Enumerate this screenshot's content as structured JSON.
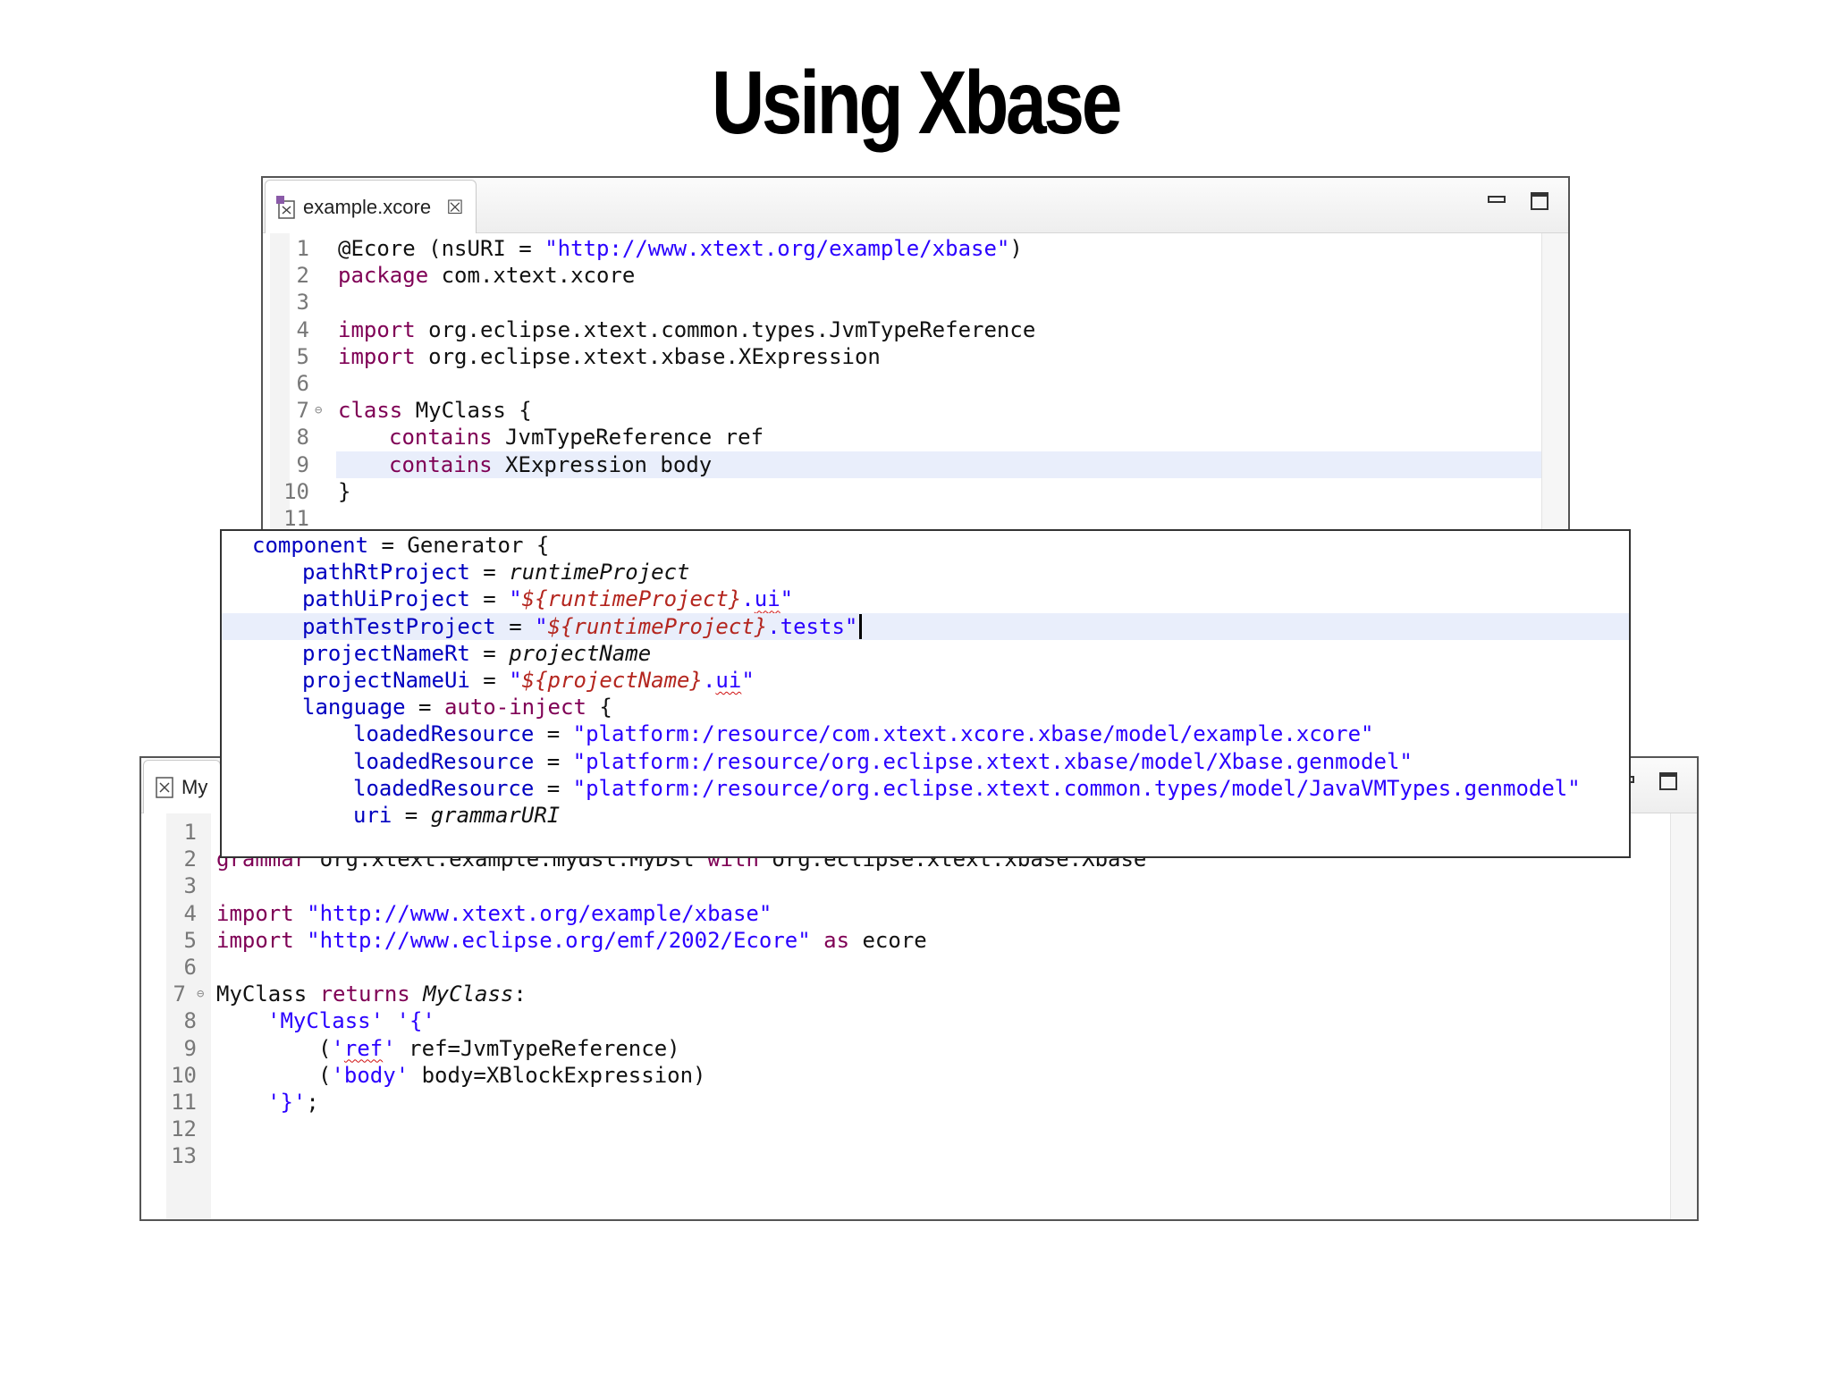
{
  "slide": {
    "title": "Using Xbase"
  },
  "xcore_editor": {
    "tab_label": "example.xcore",
    "icons": {
      "file": "xcore-file-icon",
      "close": "close-icon",
      "minimize": "minimize-icon",
      "maximize": "maximize-icon"
    },
    "line_numbers": [
      "1",
      "2",
      "3",
      "4",
      "5",
      "6",
      "7",
      "8",
      "9",
      "10",
      "11"
    ],
    "lines": {
      "l1_ecore": "@Ecore (nsURI = ",
      "l1_uri": "\"http://www.xtext.org/example/xbase\"",
      "l1_close": ")",
      "l2_kw": "package",
      "l2_rest": " com.xtext.xcore",
      "l4_kw": "import",
      "l4_rest": " org.eclipse.xtext.common.types.JvmTypeReference",
      "l5_kw": "import",
      "l5_rest": " org.eclipse.xtext.xbase.XExpression",
      "l7_kw": "class",
      "l7_rest": " MyClass {",
      "l8_kw": "contains",
      "l8_rest": " JvmTypeReference ref",
      "l9_kw": "contains",
      "l9_rest": " XExpression body",
      "l10": "}"
    }
  },
  "mwe_editor": {
    "lines": {
      "l1_prop": "component",
      "l1_rest": " = Generator {",
      "l2_prop": "pathRtProject",
      "l2_eq": " = ",
      "l2_val": "runtimeProject",
      "l3_prop": "pathUiProject",
      "l3_eq": " = ",
      "l3_q1": "\"",
      "l3_var": "${runtimeProject}",
      "l3_dot": ".",
      "l3_ui": "ui",
      "l3_q2": "\"",
      "l4_prop": "pathTestProject",
      "l4_eq": " = ",
      "l4_q1": "\"",
      "l4_var": "${runtimeProject}",
      "l4_rest": ".tests\"",
      "l5_prop": "projectNameRt",
      "l5_eq": " = ",
      "l5_val": "projectName",
      "l6_prop": "projectNameUi",
      "l6_eq": " = ",
      "l6_q1": "\"",
      "l6_var": "${projectName}",
      "l6_dot": ".",
      "l6_ui": "ui",
      "l6_q2": "\"",
      "l7_prop": "language",
      "l7_eq": " = ",
      "l7_kw": "auto-inject",
      "l7_rest": " {",
      "l8_prop": "loadedResource",
      "l8_eq": " = ",
      "l8_val": "\"platform:/resource/com.xtext.xcore.xbase/model/example.xcore\"",
      "l9_prop": "loadedResource",
      "l9_eq": " = ",
      "l9_val": "\"platform:/resource/org.eclipse.xtext.xbase/model/Xbase.genmodel\"",
      "l10_prop": "loadedResource",
      "l10_eq": " = ",
      "l10_val": "\"platform:/resource/org.eclipse.xtext.common.types/model/JavaVMTypes.genmodel\"",
      "l11_prop": "uri",
      "l11_eq": " = ",
      "l11_val": "grammarURI"
    }
  },
  "grammar_editor": {
    "tab_label": "My",
    "icons": {
      "file": "xtext-file-icon",
      "minimize": "minimize-icon",
      "maximize": "maximize-icon"
    },
    "line_numbers": [
      "1",
      "2",
      "3",
      "4",
      "5",
      "6",
      "7",
      "8",
      "9",
      "10",
      "11",
      "12",
      "13"
    ],
    "lines": {
      "l2_kw": "grammar",
      "l2_rest": " org.xtext.example.mydsl.MyDsl ",
      "l2_with": "with",
      "l2_rest2": " org.eclipse.xtext.xbase.Xbase",
      "l4_kw": "import",
      "l4_str": " \"http://www.xtext.org/example/xbase\"",
      "l5_kw": "import",
      "l5_str": " \"http://www.eclipse.org/emf/2002/Ecore\"",
      "l5_as": " as",
      "l5_rest": " ecore",
      "l7_name": "MyClass",
      "l7_kw": " returns",
      "l7_type": " MyClass",
      "l7_colon": ":",
      "l8_str": "'MyClass' '{'",
      "l9_open": "(",
      "l9_q1": "'",
      "l9_ref": "ref",
      "l9_q2": "'",
      "l9_rest": " ref=JvmTypeReference)",
      "l10_open": "(",
      "l10_str": "'body'",
      "l10_rest": " body=XBlockExpression)",
      "l11_str": "'}'",
      "l11_semi": ";"
    }
  }
}
